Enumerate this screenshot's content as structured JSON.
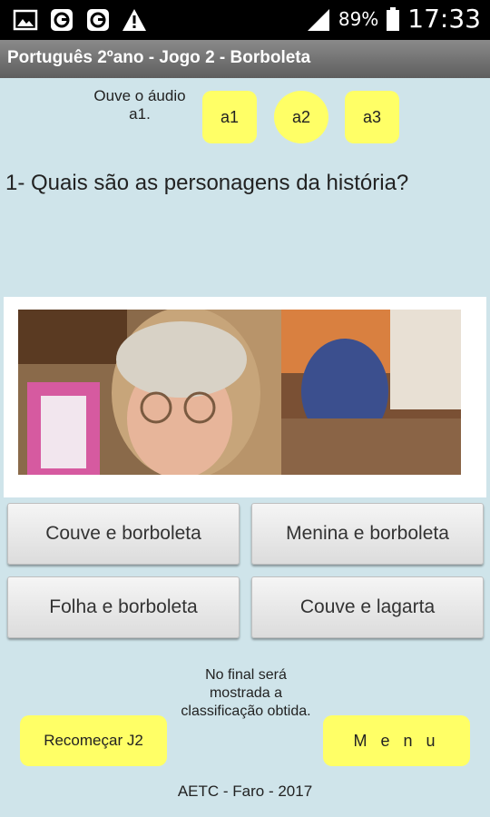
{
  "status_bar": {
    "icons": [
      "image-icon",
      "g-app-icon",
      "g-app-icon",
      "warning-icon"
    ],
    "signal": "signal-icon",
    "battery_percent": "89%",
    "clock": "17:33"
  },
  "title_bar": {
    "title": "Português 2ºano - Jogo 2 - Borboleta"
  },
  "audio": {
    "label": "Ouve o áudio a1.",
    "buttons": [
      "a1",
      "a2",
      "a3"
    ],
    "color": "#ffff66"
  },
  "question": "1- Quais são as personagens da história?",
  "answers": [
    "Couve e borboleta",
    "Menina e borboleta",
    "Folha e borboleta",
    "Couve e lagarta"
  ],
  "info_text": "No final será mostrada a classificação obtida.",
  "buttons": {
    "restart": "Recomeçar J2",
    "menu": "M e n u"
  },
  "footer": "AETC - Faro - 2017",
  "colors": {
    "background": "#cfe4ea",
    "accent": "#ffff66",
    "title_bar": "#707070"
  }
}
